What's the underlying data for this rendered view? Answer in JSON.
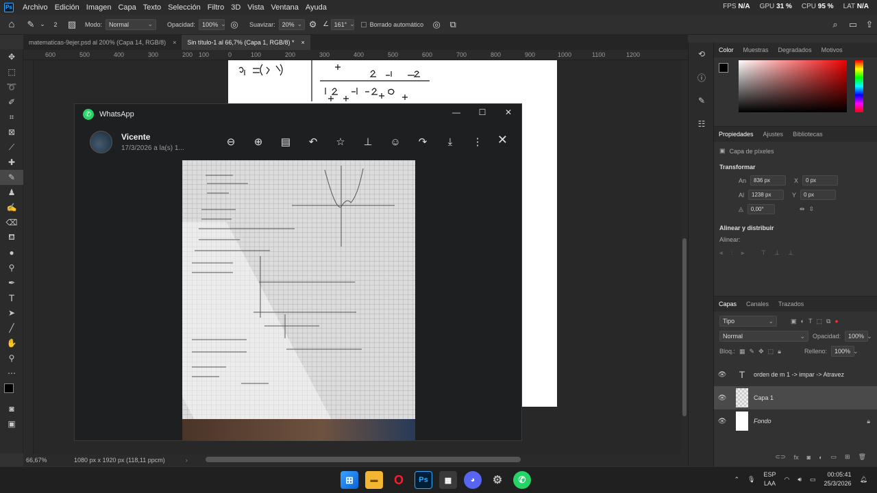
{
  "menubar": {
    "items": [
      "Archivo",
      "Edición",
      "Imagen",
      "Capa",
      "Texto",
      "Selección",
      "Filtro",
      "3D",
      "Vista",
      "Ventana",
      "Ayuda"
    ],
    "perf": {
      "fps_label": "FPS",
      "fps": "N/A",
      "gpu_label": "GPU",
      "gpu": "31 %",
      "cpu_label": "CPU",
      "cpu": "95 %",
      "lat_label": "LAT",
      "lat": "N/A"
    }
  },
  "options": {
    "brush_size": "2",
    "mode_label": "Modo:",
    "mode": "Normal",
    "opacity_label": "Opacidad:",
    "opacity": "100%",
    "smooth_label": "Suavizar:",
    "smooth": "20%",
    "angle": "161°",
    "autoerase": "Borrado automático"
  },
  "tabs": [
    {
      "label": "matematicas-9ejer.psd al 200% (Capa 14, RGB/8)"
    },
    {
      "label": "Sin título-1 al 66,7% (Capa 1, RGB/8) *"
    }
  ],
  "ruler_labels": [
    "600",
    "500",
    "400",
    "300",
    "200",
    "100",
    "0",
    "100",
    "200",
    "300",
    "400",
    "500",
    "600",
    "700",
    "800",
    "900",
    "1000",
    "1100",
    "1200"
  ],
  "status": {
    "zoom": "66,67%",
    "size": "1080 px x 1920 px (118,11 ppcm)"
  },
  "whatsapp": {
    "app_title": "WhatsApp",
    "contact": "Vicente",
    "date": "17/3/2026 a la(s) 1..."
  },
  "color_panel": {
    "tabs": [
      "Color",
      "Muestras",
      "Degradados",
      "Motivos"
    ]
  },
  "properties": {
    "tabs": [
      "Propiedades",
      "Ajustes",
      "Bibliotecas"
    ],
    "kind": "Capa de píxeles",
    "transform_title": "Transformar",
    "an_label": "An",
    "an": "836 px",
    "x_label": "X",
    "x": "0 px",
    "al_label": "Al",
    "al": "1238 px",
    "y_label": "Y",
    "y": "0 px",
    "angle": "0,00°",
    "align_title": "Alinear y distribuir",
    "align_label": "Alinear:"
  },
  "layers": {
    "tabs": [
      "Capas",
      "Canales",
      "Trazados"
    ],
    "filter": "Tipo",
    "blend": "Normal",
    "opacity_label": "Opacidad:",
    "opacity": "100%",
    "lock_label": "Bloq.:",
    "fill_label": "Relleno:",
    "fill": "100%",
    "items": [
      {
        "name": "orden de m 1  -> impar -> Atravez",
        "type": "text"
      },
      {
        "name": "Capa 1",
        "type": "pixel"
      },
      {
        "name": "Fondo",
        "type": "background"
      }
    ]
  },
  "taskbar": {
    "lang": "ESP",
    "layout": "LAA",
    "time": "00:05:41",
    "date": "25/3/2026"
  },
  "accent": "#31a8ff"
}
